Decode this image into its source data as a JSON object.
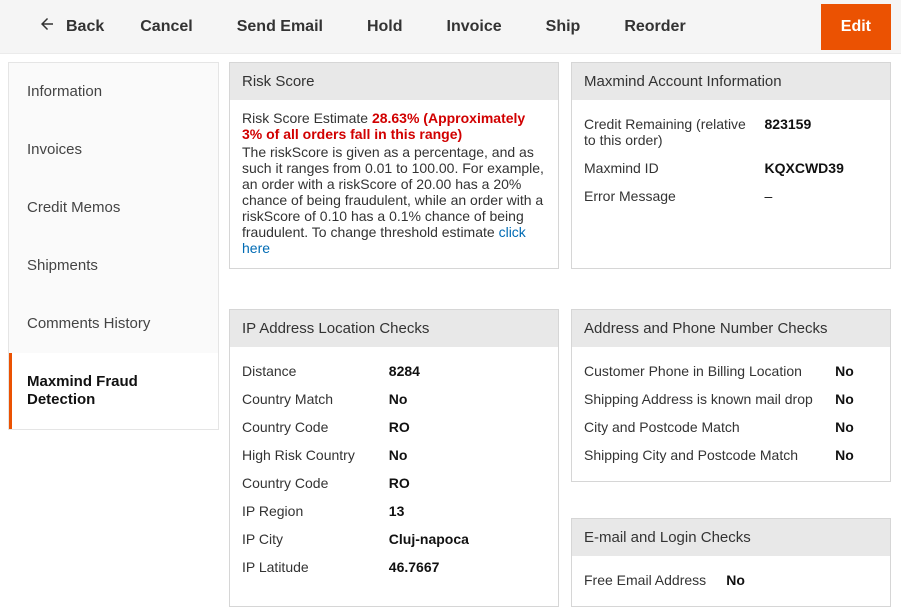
{
  "toolbar": {
    "back": "Back",
    "cancel": "Cancel",
    "send_email": "Send Email",
    "hold": "Hold",
    "invoice": "Invoice",
    "ship": "Ship",
    "reorder": "Reorder",
    "edit": "Edit"
  },
  "sidebar": {
    "items": [
      {
        "label": "Information"
      },
      {
        "label": "Invoices"
      },
      {
        "label": "Credit Memos"
      },
      {
        "label": "Shipments"
      },
      {
        "label": "Comments History"
      },
      {
        "label": "Maxmind Fraud Detection"
      }
    ]
  },
  "risk_score": {
    "header": "Risk Score",
    "prefix": "Risk Score Estimate ",
    "percentage": "28.63% (Approximately 3% of all orders fall in this range)",
    "description": "The riskScore is given as a percentage, and as such it ranges from 0.01 to 100.00. For example, an order with a riskScore of 20.00 has a 20% chance of being fraudulent, while an order with a riskScore of 0.10 has a 0.1% chance of being fraudulent. To change threshold estimate ",
    "click_here": "click here"
  },
  "maxmind_account": {
    "header": "Maxmind Account Information",
    "rows": [
      {
        "label": "Credit Remaining (relative to this order)",
        "value": "823159"
      },
      {
        "label": "Maxmind ID",
        "value": "KQXCWD39"
      },
      {
        "label": "Error Message",
        "value": "–",
        "plain": true
      }
    ]
  },
  "ip_checks": {
    "header": "IP Address Location Checks",
    "rows": [
      {
        "label": "Distance",
        "value": "8284"
      },
      {
        "label": "Country Match",
        "value": "No"
      },
      {
        "label": "Country Code",
        "value": "RO"
      },
      {
        "label": "High Risk Country",
        "value": "No"
      },
      {
        "label": "Country Code",
        "value": "RO"
      },
      {
        "label": "IP Region",
        "value": "13"
      },
      {
        "label": "IP City",
        "value": "Cluj-napoca"
      },
      {
        "label": "IP Latitude",
        "value": "46.7667"
      }
    ]
  },
  "addr_checks": {
    "header": "Address and Phone Number Checks",
    "rows": [
      {
        "label": "Customer Phone in Billing Location",
        "value": "No"
      },
      {
        "label": "Shipping Address is known mail drop",
        "value": "No"
      },
      {
        "label": "City and Postcode Match",
        "value": "No"
      },
      {
        "label": "Shipping City and Postcode Match",
        "value": "No"
      }
    ]
  },
  "email_checks": {
    "header": "E-mail and Login Checks",
    "rows": [
      {
        "label": "Free Email Address",
        "value": "No"
      }
    ]
  }
}
